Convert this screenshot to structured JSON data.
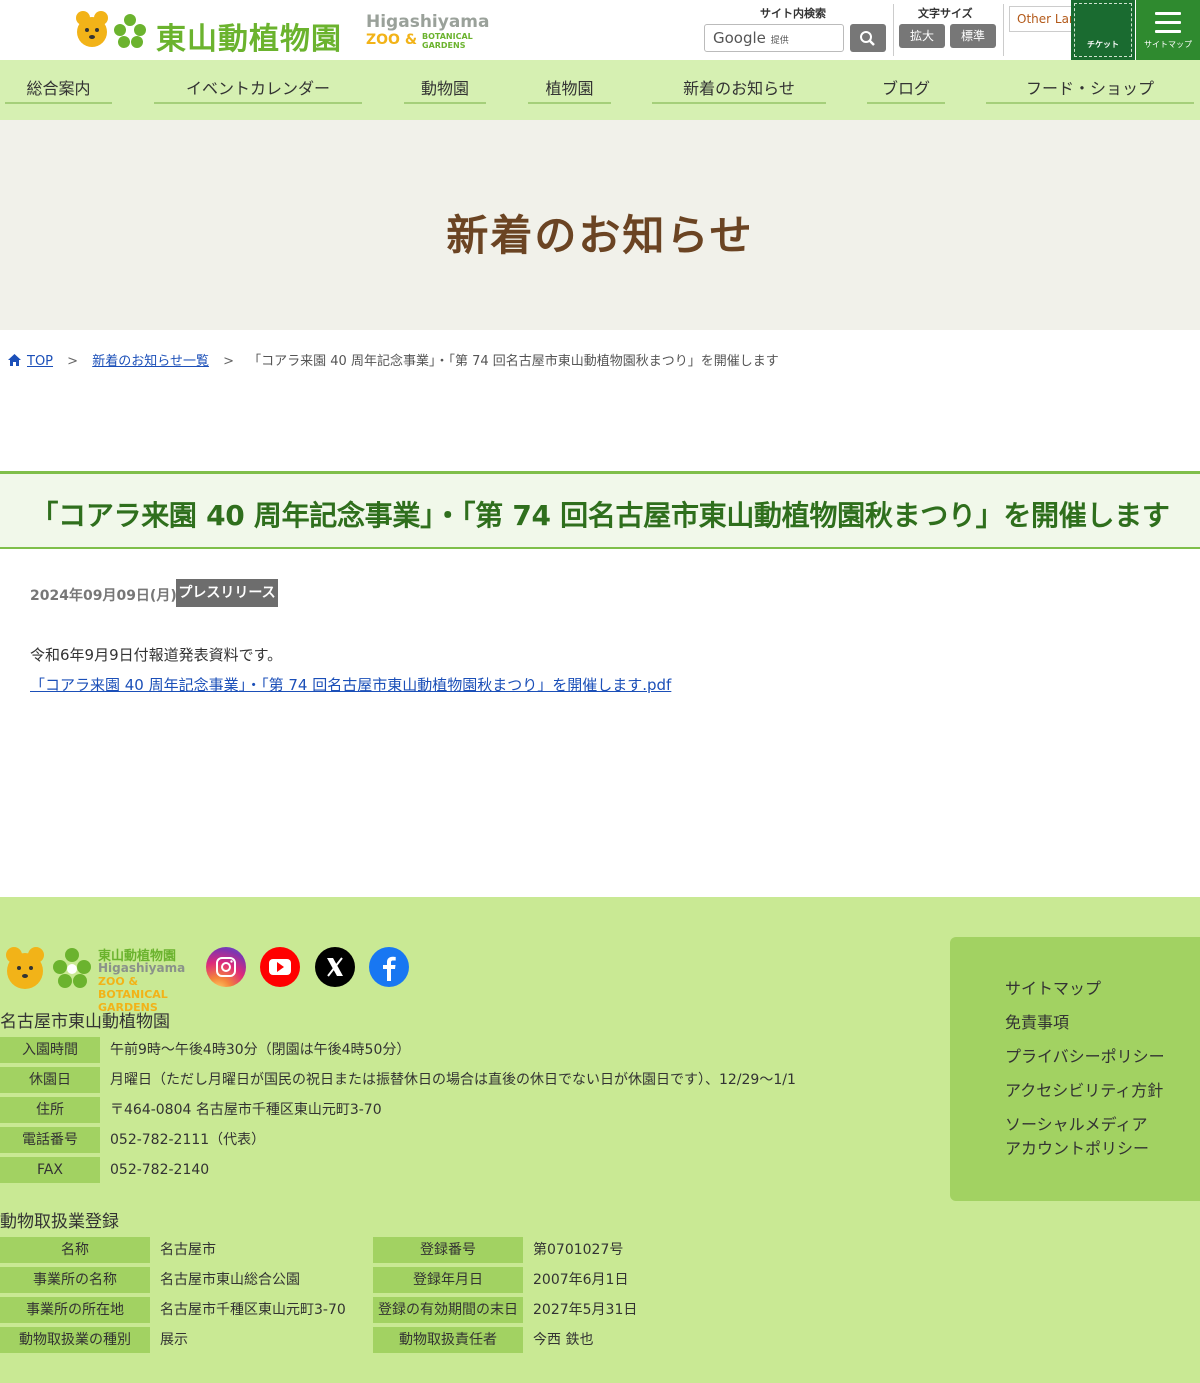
{
  "header": {
    "logo_jp": "東山動植物園",
    "logo_en1": "Higashiyama",
    "logo_en2": "ZOO &",
    "logo_en3": "BOTANICAL GARDENS",
    "search_label": "サイト内検索",
    "search_google": "Google",
    "search_provided": "提供",
    "fontsize_label": "文字サイズ",
    "fontsize_big": "拡大",
    "fontsize_std": "標準",
    "language": "Other Languages",
    "ticket": "チケット",
    "sitemap": "サイトマップ"
  },
  "nav": [
    {
      "label": "総合案内"
    },
    {
      "label": "イベントカレンダー"
    },
    {
      "label": "動物園"
    },
    {
      "label": "植物園"
    },
    {
      "label": "新着のお知らせ"
    },
    {
      "label": "ブログ"
    },
    {
      "label": "フード・ショップ"
    }
  ],
  "page_title": "新着のお知らせ",
  "breadcrumb": {
    "top": "TOP",
    "list": "新着のお知らせ一覧",
    "current": "「コアラ来園 40 周年記念事業」・「第 74 回名古屋市東山動植物園秋まつり」を開催します",
    "sep": ">"
  },
  "article": {
    "title": "「コアラ来園 40 周年記念事業」・「第 74 回名古屋市東山動植物園秋まつり」を開催します",
    "date": "2024年09月09日(月)",
    "tag": "プレスリリース",
    "body": "令和6年9月9日付報道発表資料です。",
    "pdf_link": "「コアラ来園 40 周年記念事業」・「第 74 回名古屋市東山動植物園秋まつり」を開催します.pdf"
  },
  "footer": {
    "logo_t1": "東山動植物園",
    "logo_t2": "Higashiyama",
    "logo_t3": "ZOO & BOTANICAL GARDENS",
    "org_name": "名古屋市東山動植物園",
    "info": [
      {
        "label": "入園時間",
        "value": "午前9時～午後4時30分（閉園は午後4時50分）"
      },
      {
        "label": "休園日",
        "value": "月曜日（ただし月曜日が国民の祝日または振替休日の場合は直後の休日でない日が休園日です）、12/29～1/1"
      },
      {
        "label": "住所",
        "value": "〒464-0804 名古屋市千種区東山元町3-70"
      },
      {
        "label": "電話番号",
        "value": "052-782-2111（代表）"
      },
      {
        "label": "FAX",
        "value": "052-782-2140"
      }
    ],
    "registration_title": "動物取扱業登録",
    "registration_left": [
      {
        "label": "名称",
        "value": "名古屋市"
      },
      {
        "label": "事業所の名称",
        "value": "名古屋市東山総合公園"
      },
      {
        "label": "事業所の所在地",
        "value": "名古屋市千種区東山元町3-70"
      },
      {
        "label": "動物取扱業の種別",
        "value": "展示"
      }
    ],
    "registration_right": [
      {
        "label": "登録番号",
        "value": "第0701027号"
      },
      {
        "label": "登録年月日",
        "value": "2007年6月1日"
      },
      {
        "label": "登録の有効期間の末日",
        "value": "2027年5月31日"
      },
      {
        "label": "動物取扱責任者",
        "value": "今西 鉄也"
      }
    ],
    "links": [
      "サイトマップ",
      "免責事項",
      "プライバシーポリシー",
      "アクセシビリティ方針",
      "ソーシャルメディア",
      "アカウントポリシー"
    ]
  }
}
